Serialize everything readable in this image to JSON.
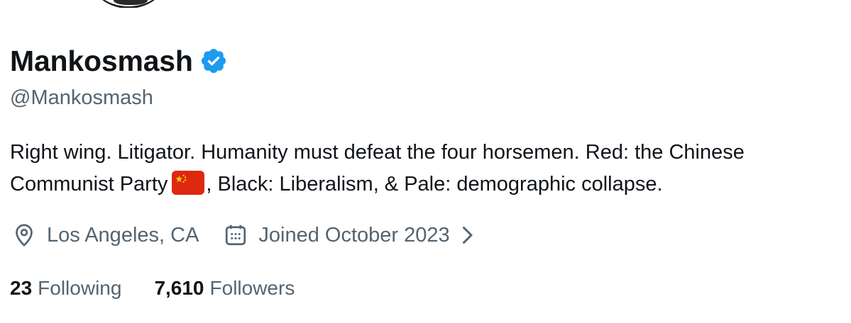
{
  "profile": {
    "display_name": "Mankosmash",
    "handle": "@Mankosmash",
    "verified_icon": "verified-badge-icon",
    "bio_part1": "Right wing. Litigator. Humanity must defeat the four horsemen. Red: the Chinese Communist Party",
    "bio_flag": "flag-china-icon",
    "bio_part2": ", Black: Liberalism, & Pale: demographic collapse.",
    "location": "Los Angeles, CA",
    "joined": "Joined October 2023",
    "following_count": "23",
    "following_label": "Following",
    "followers_count": "7,610",
    "followers_label": "Followers"
  },
  "colors": {
    "text_primary": "#0f1419",
    "text_secondary": "#536471",
    "verified_blue": "#1d9bf0",
    "flag_red": "#de2910",
    "flag_yellow": "#ffde00"
  }
}
